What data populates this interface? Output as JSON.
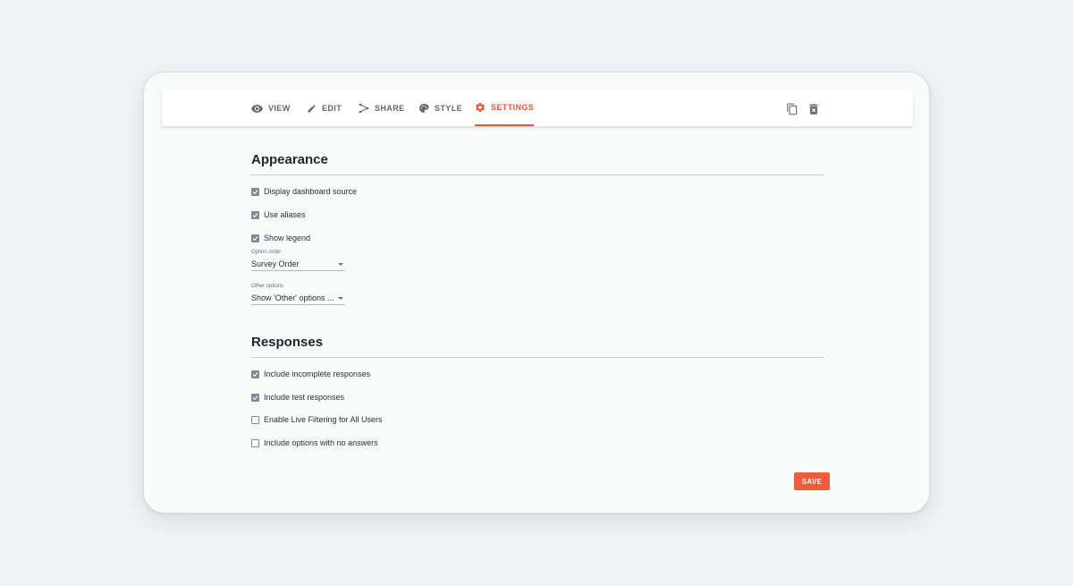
{
  "tabs": [
    {
      "label": "VIEW",
      "icon": "eye-icon"
    },
    {
      "label": "EDIT",
      "icon": "pencil-icon"
    },
    {
      "label": "SHARE",
      "icon": "share-icon"
    },
    {
      "label": "STYLE",
      "icon": "palette-icon"
    },
    {
      "label": "SETTINGS",
      "icon": "gear-icon",
      "active": true
    }
  ],
  "toolbar": {
    "copy_icon": "copy-icon",
    "delete_icon": "delete-icon"
  },
  "appearance": {
    "title": "Appearance",
    "checkboxes": [
      {
        "label": "Display dashboard source",
        "checked": true
      },
      {
        "label": "Use aliases",
        "checked": true
      },
      {
        "label": "Show legend",
        "checked": true
      }
    ],
    "option_order": {
      "label": "Option order",
      "value": "Survey Order"
    },
    "other_options": {
      "label": "Other options",
      "value": "Show 'Other' options ..."
    }
  },
  "responses": {
    "title": "Responses",
    "checkboxes": [
      {
        "label": "Include incomplete responses",
        "checked": true
      },
      {
        "label": "Include test responses",
        "checked": true
      },
      {
        "label": "Enable Live Filtering for All Users",
        "checked": false
      },
      {
        "label": "Include options with no answers",
        "checked": false
      }
    ]
  },
  "save_label": "SAVE",
  "colors": {
    "accent": "#e8553e",
    "save": "#f25a3c",
    "checkbox": "#7e8a9a"
  }
}
